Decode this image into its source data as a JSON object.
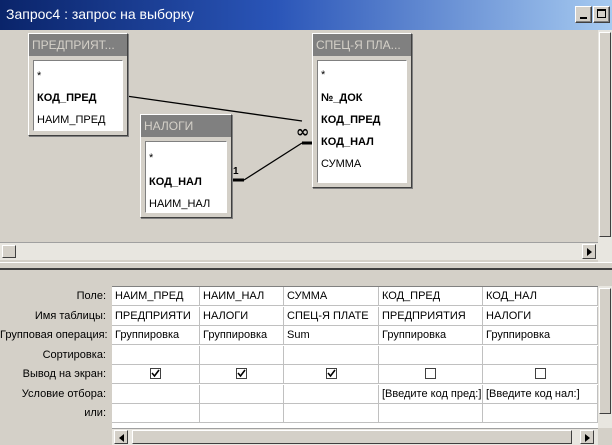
{
  "window": {
    "title": "Запрос4 : запрос на выборку"
  },
  "tables": {
    "predpriyatiya": {
      "title": "ПРЕДПРИЯТ...",
      "fields": [
        "*",
        "КОД_ПРЕД",
        "НАИМ_ПРЕД"
      ],
      "key_fields": [
        "КОД_ПРЕД"
      ]
    },
    "nalogi": {
      "title": "НАЛОГИ",
      "fields": [
        "*",
        "КОД_НАЛ",
        "НАИМ_НАЛ"
      ],
      "key_fields": [
        "КОД_НАЛ"
      ]
    },
    "spec": {
      "title": "СПЕЦ-Я ПЛА...",
      "fields": [
        "*",
        "№_ДОК",
        "КОД_ПРЕД",
        "КОД_НАЛ",
        "СУММА"
      ],
      "key_fields": [
        "№_ДОК",
        "КОД_ПРЕД",
        "КОД_НАЛ"
      ]
    }
  },
  "relations": {
    "one_label": "1",
    "many_label": "∞"
  },
  "grid": {
    "row_labels": [
      "Поле:",
      "Имя таблицы:",
      "Групповая операция:",
      "Сортировка:",
      "Вывод на экран:",
      "Условие отбора:",
      "или:"
    ],
    "columns": [
      {
        "field": "НАИМ_ПРЕД",
        "table": "ПРЕДПРИЯТИ",
        "group": "Группировка",
        "sort": "",
        "show": true,
        "criteria": ""
      },
      {
        "field": "НАИМ_НАЛ",
        "table": "НАЛОГИ",
        "group": "Группировка",
        "sort": "",
        "show": true,
        "criteria": ""
      },
      {
        "field": "СУММА",
        "table": "СПЕЦ-Я ПЛАТЕ",
        "group": "Sum",
        "sort": "",
        "show": true,
        "criteria": ""
      },
      {
        "field": "КОД_ПРЕД",
        "table": "ПРЕДПРИЯТИЯ",
        "group": "Группировка",
        "sort": "",
        "show": false,
        "criteria": "[Введите код пред:]"
      },
      {
        "field": "КОД_НАЛ",
        "table": "НАЛОГИ",
        "group": "Группировка",
        "sort": "",
        "show": false,
        "criteria": "[Введите код нал:]"
      }
    ]
  }
}
